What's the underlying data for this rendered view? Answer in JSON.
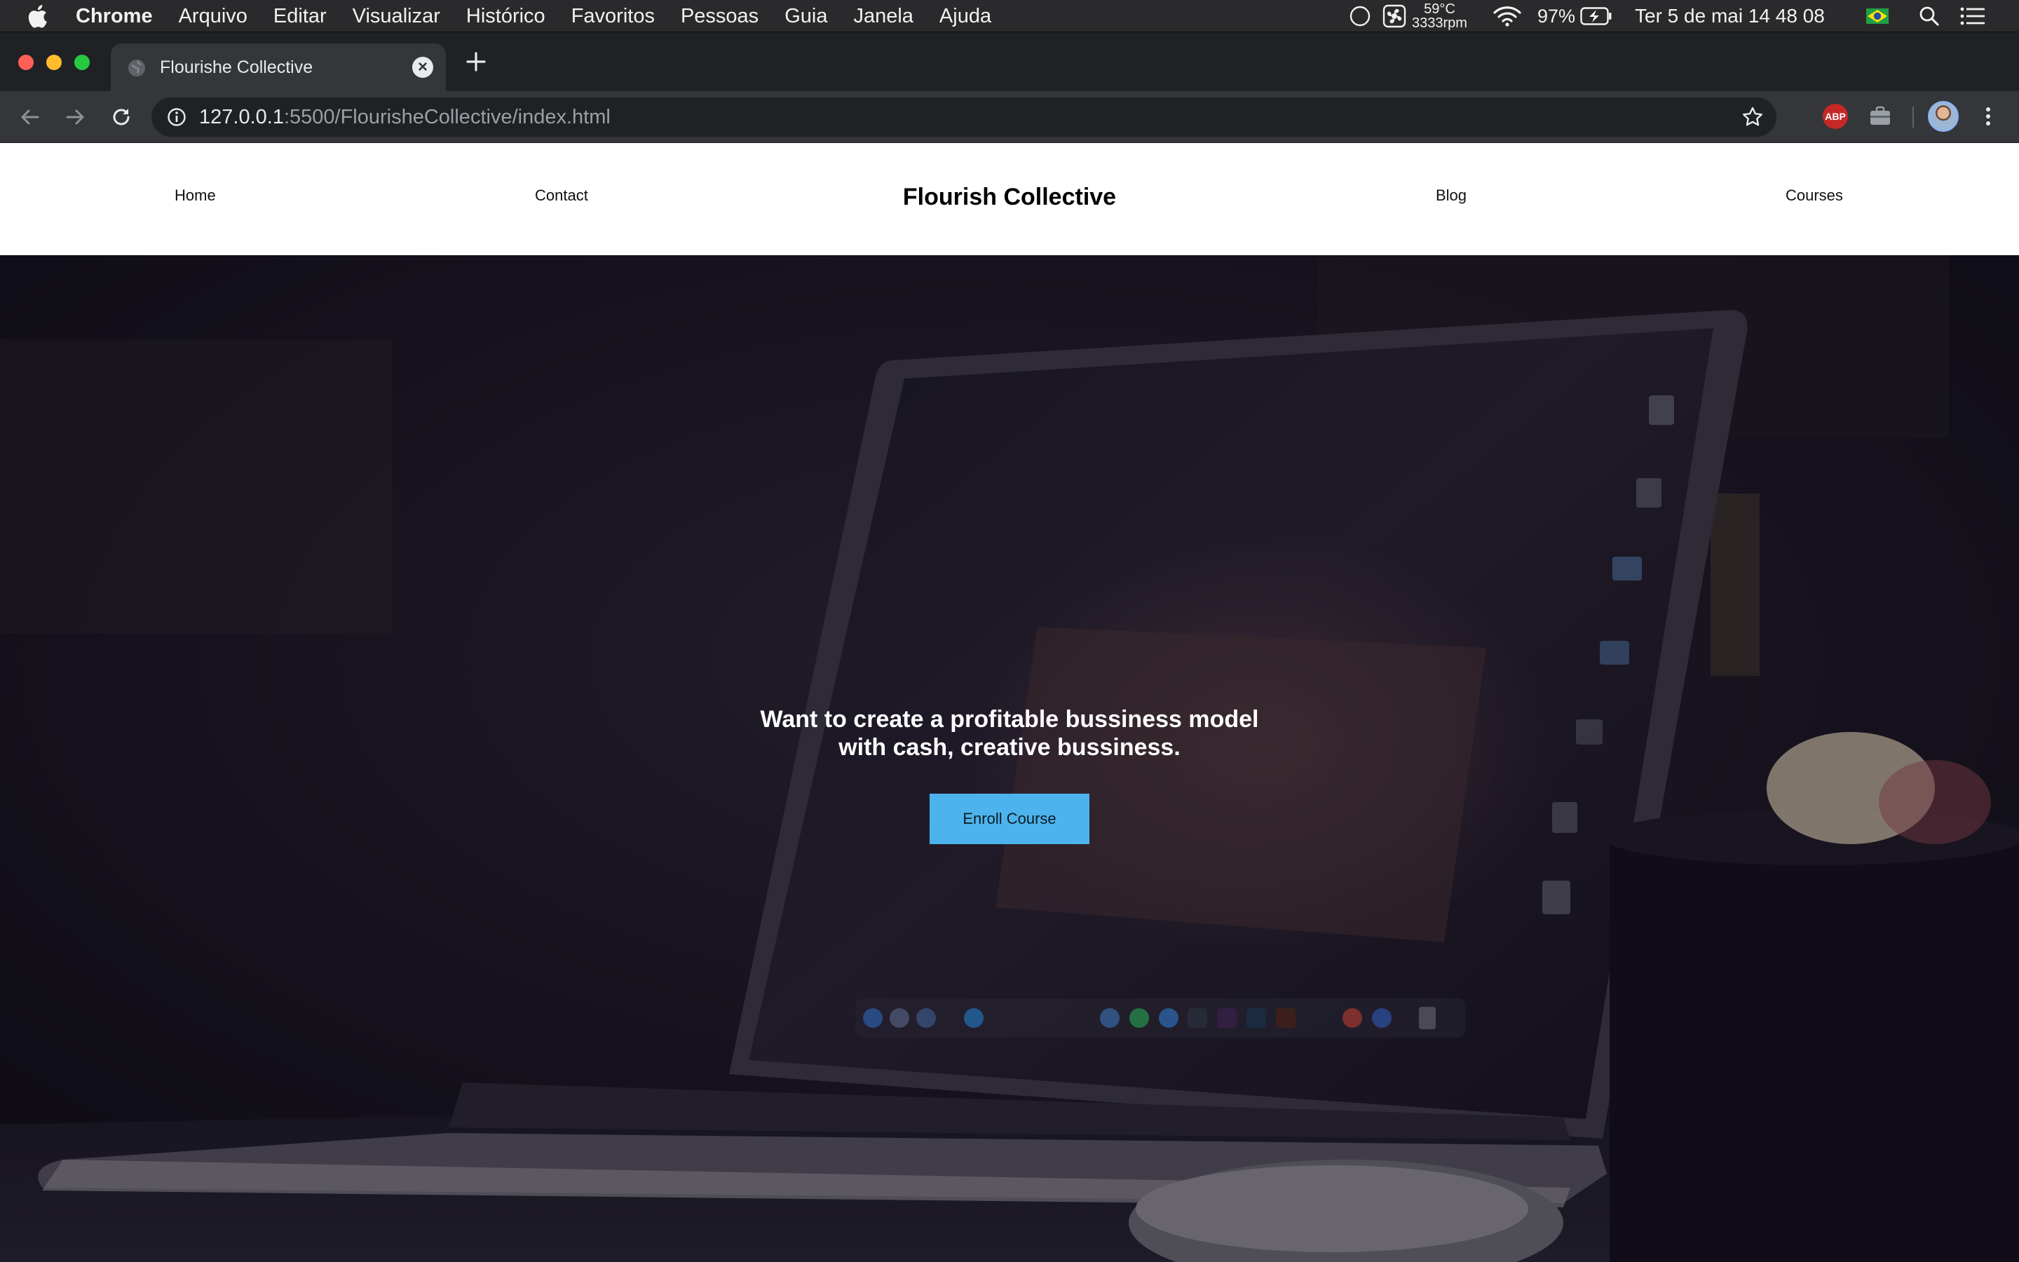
{
  "menubar": {
    "app_name": "Chrome",
    "menus": [
      "Arquivo",
      "Editar",
      "Visualizar",
      "Histórico",
      "Favoritos",
      "Pessoas",
      "Guia",
      "Janela",
      "Ajuda"
    ],
    "temperature": "59°C",
    "fan_speed": "3333rpm",
    "battery": "97%",
    "datetime": "Ter 5 de mai  14 48 08"
  },
  "tab": {
    "title": "Flourishe Collective"
  },
  "address_bar": {
    "host": "127.0.0.1",
    "rest": ":5500/FlourisheCollective/index.html"
  },
  "extensions": {
    "abp_label": "ABP"
  },
  "site": {
    "brand": "Flourish Collective",
    "nav": {
      "home": "Home",
      "contact": "Contact",
      "blog": "Blog",
      "courses": "Courses"
    },
    "hero": {
      "headline_line1": "Want to create a profitable bussiness model",
      "headline_line2": "with cash, creative bussiness.",
      "cta_label": "Enroll Course"
    }
  },
  "colors": {
    "cta": "#4db3ec",
    "hero_dark": "#141219",
    "chrome_toolbar": "#35363a"
  }
}
